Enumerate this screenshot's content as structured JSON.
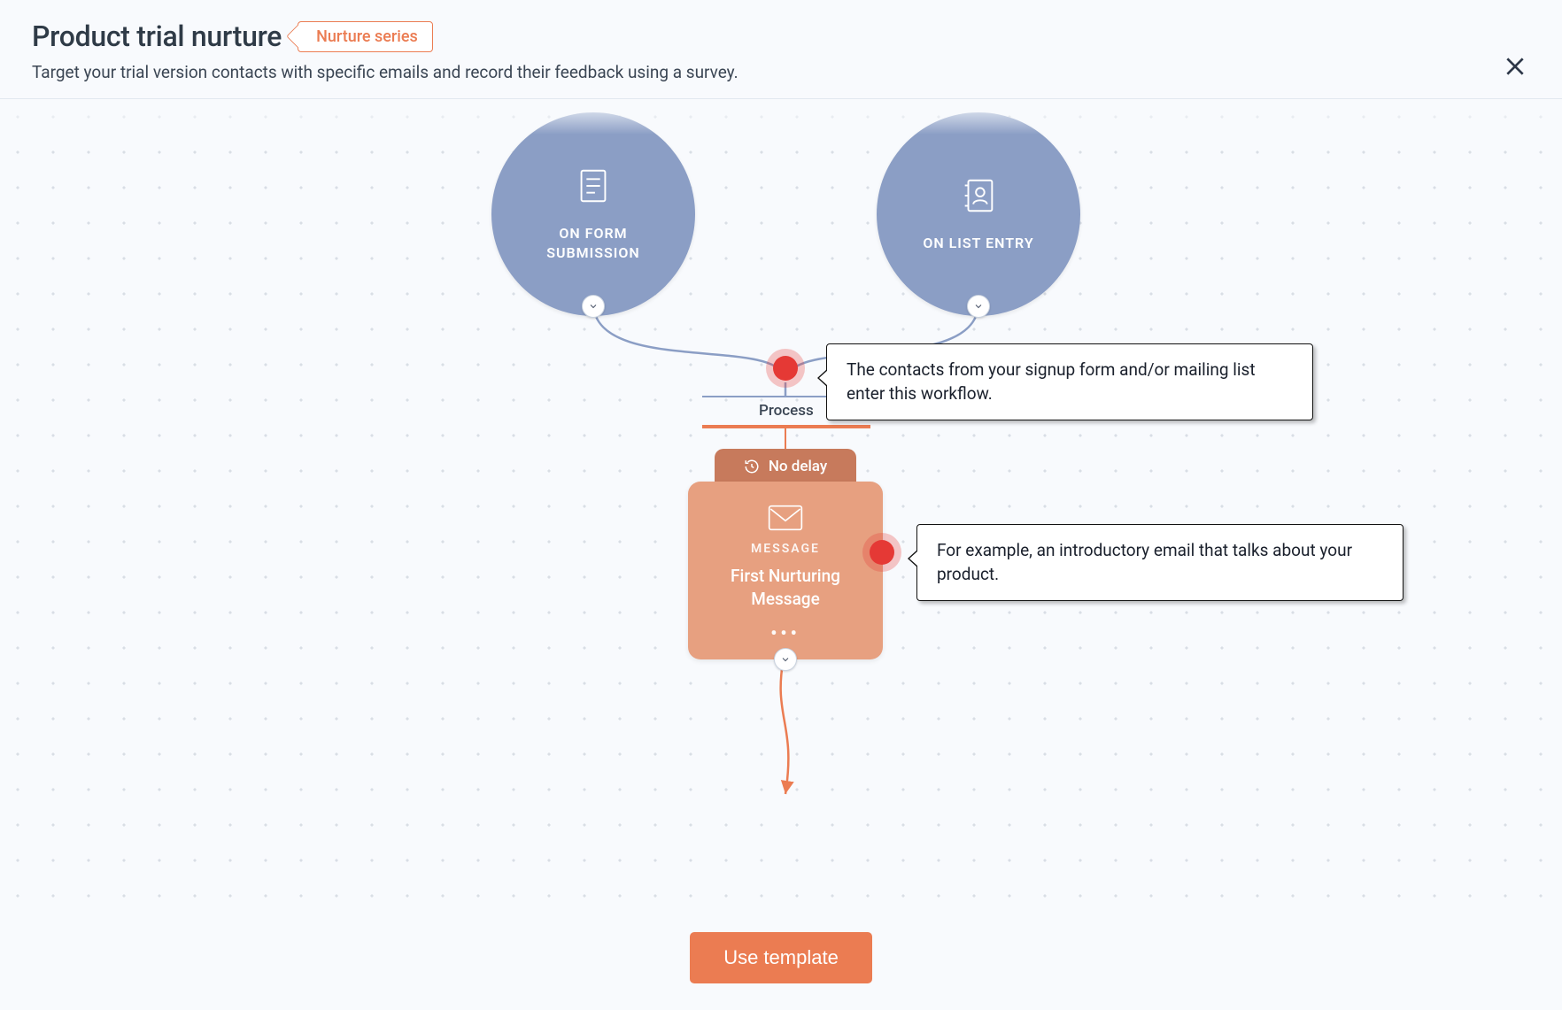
{
  "header": {
    "title": "Product trial nurture",
    "tag": "Nurture series",
    "subtitle": "Target your trial version contacts with specific emails and record their feedback using a survey."
  },
  "triggers": {
    "form": {
      "label": "ON FORM SUBMISSION",
      "icon": "form-icon"
    },
    "list": {
      "label": "ON LIST ENTRY",
      "icon": "contact-book-icon"
    }
  },
  "process": {
    "label": "Process"
  },
  "delay": {
    "label": "No delay"
  },
  "message": {
    "type": "MESSAGE",
    "title": "First Nurturing Message"
  },
  "callouts": {
    "entry": "The contacts from your signup form and/or mailing list enter this workflow.",
    "message": "For example, an introductory email that talks about your product."
  },
  "footer": {
    "cta": "Use template"
  }
}
